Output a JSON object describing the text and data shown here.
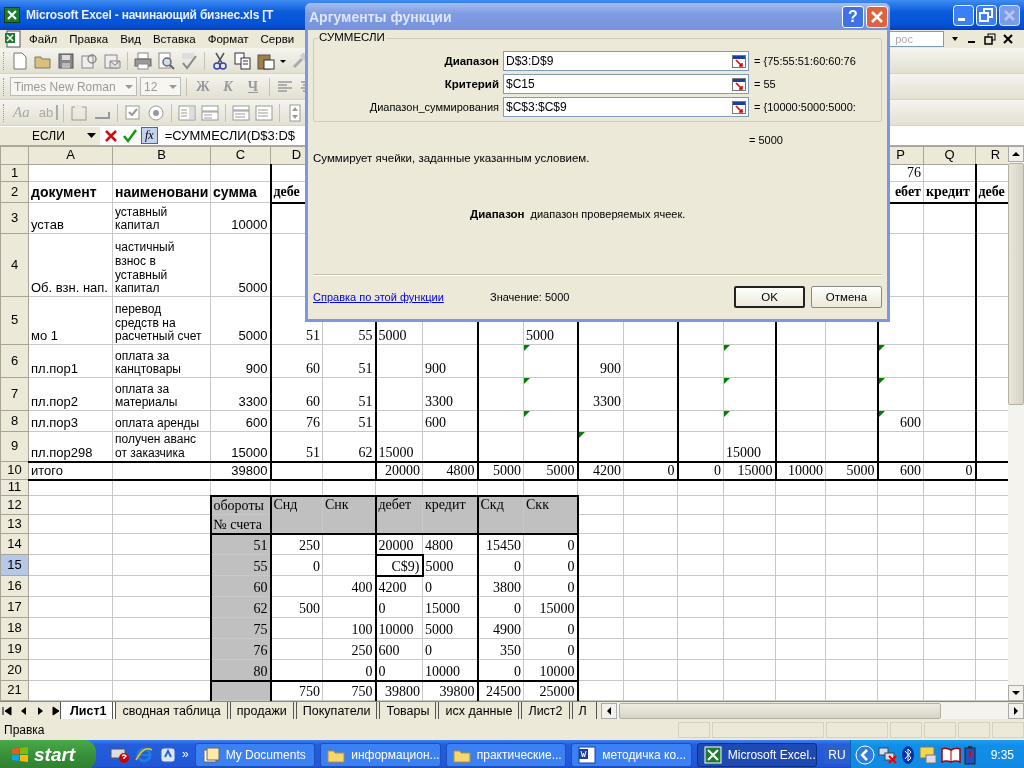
{
  "window": {
    "title": "Microsoft Excel - начинающий бизнес.xls  [T"
  },
  "menu": {
    "items": [
      "Файл",
      "Правка",
      "Вид",
      "Вставка",
      "Формат",
      "Серви"
    ],
    "help_box": {
      "placeholder": "рос"
    }
  },
  "formatting_toolbar": {
    "font": "Times New Roman",
    "size": "12",
    "styles": [
      "Ж",
      "К",
      "Ч"
    ]
  },
  "forms_toolbar": {
    "label_tool": "Aa",
    "edit_box_tool": "ab"
  },
  "formula_bar": {
    "name_box": "ЕСЛИ",
    "function_button": "fx",
    "formula": "=СУММЕСЛИ(D$3:D$"
  },
  "sheet": {
    "columns": [
      "A",
      "B",
      "C",
      "D",
      null,
      null,
      null,
      null,
      null,
      null,
      null,
      null,
      null,
      null,
      null,
      "P",
      "Q",
      "R"
    ],
    "rows": [
      {
        "label": "1",
        "selected": false,
        "cells": {
          "P": "76"
        }
      },
      {
        "label": "2",
        "selected": false,
        "cells": {
          "A": {
            "text": "документ",
            "kind": "header"
          },
          "B": {
            "text": "наименовани",
            "kind": "header"
          },
          "C": {
            "text": "сумма",
            "kind": "header"
          },
          "D": {
            "text": "дебе",
            "kind": "header"
          },
          "P": {
            "text": "ебет",
            "kind": "header_right"
          },
          "Q": {
            "text": "кредит",
            "kind": "header"
          },
          "R": {
            "text": "дебе",
            "kind": "header"
          }
        }
      },
      {
        "label": "3",
        "selected": false,
        "cells": {
          "A": {
            "text": "устав",
            "kind": "text"
          },
          "B": {
            "text": "уставный капитал",
            "kind": "text"
          },
          "C": "10000"
        }
      },
      {
        "label": "4",
        "selected": false,
        "cells": {
          "A": {
            "text": "Об. взн. нап.",
            "kind": "text"
          },
          "B": {
            "text": "частичный взнос в уставный капитал",
            "kind": "text"
          },
          "C": "5000"
        }
      },
      {
        "label": "5",
        "selected": false,
        "cells": {
          "A": {
            "text": "мо 1",
            "kind": "text"
          },
          "B": {
            "text": "перевод средств на расчетный счет",
            "kind": "text"
          },
          "C": "5000",
          "D": "51",
          "E": "55",
          "F": {
            "text": "5000",
            "kind": "text"
          },
          "I": {
            "text": "5000",
            "kind": "text"
          }
        }
      },
      {
        "label": "6",
        "selected": false,
        "cells": {
          "A": {
            "text": "пл.пор1",
            "kind": "text"
          },
          "B": {
            "text": "оплата за канцтовары",
            "kind": "text"
          },
          "C": "900",
          "D": "60",
          "E": "51",
          "G": {
            "text": "900",
            "kind": "text"
          },
          "I": {
            "flagged": true
          },
          "J": "900",
          "M": {
            "flagged": true
          },
          "P": {
            "flagged": true
          }
        }
      },
      {
        "label": "7",
        "selected": false,
        "cells": {
          "A": {
            "text": "пл.пор2",
            "kind": "text"
          },
          "B": {
            "text": "оплата за материалы",
            "kind": "text"
          },
          "C": "3300",
          "D": "60",
          "E": "51",
          "G": {
            "text": "3300",
            "kind": "text"
          },
          "I": {
            "flagged": true
          },
          "J": "3300",
          "M": {
            "flagged": true
          },
          "P": {
            "flagged": true
          }
        }
      },
      {
        "label": "8",
        "selected": false,
        "cells": {
          "A": {
            "text": "пл.пор3",
            "kind": "text"
          },
          "B": {
            "text": "оплата аренды",
            "kind": "text"
          },
          "C": "600",
          "D": "76",
          "E": "51",
          "G": {
            "text": "600",
            "kind": "text"
          },
          "I": {
            "flagged": true
          },
          "M": {
            "flagged": true
          },
          "P": {
            "text": "600",
            "flagged": true
          }
        }
      },
      {
        "label": "9",
        "selected": false,
        "cells": {
          "A": {
            "text": "пл.пор298",
            "kind": "text"
          },
          "B": {
            "text": "получен аванс от заказчика",
            "kind": "text"
          },
          "C": "15000",
          "D": "51",
          "E": "62",
          "F": {
            "text": "15000",
            "kind": "text"
          },
          "J": {
            "flagged": true
          },
          "M": {
            "text": "15000",
            "kind": "text"
          }
        }
      },
      {
        "label": "10",
        "selected": false,
        "cells": {
          "A": {
            "text": "итого",
            "kind": "text"
          },
          "C": "39800",
          "F": "20000",
          "G": "4800",
          "H": "5000",
          "I": "5000",
          "J": "4200",
          "K": "0",
          "L": "0",
          "M": "15000",
          "N": "10000",
          "O": "5000",
          "P": "600",
          "Q": "0"
        }
      },
      {
        "label": "11",
        "selected": false,
        "cells": {}
      },
      {
        "label": "12",
        "selected": false,
        "cells": {
          "C": {
            "text": "обороты",
            "kind": "text",
            "shaded": true
          },
          "D": {
            "text": "Снд",
            "kind": "text",
            "shaded": true,
            "merged": true
          },
          "E": {
            "text": "Снк",
            "kind": "text",
            "shaded": true,
            "merged": true
          },
          "F": {
            "text": "дебет",
            "kind": "text",
            "shaded": true,
            "merged": true
          },
          "G": {
            "text": "кредит",
            "kind": "text",
            "shaded": true,
            "merged": true
          },
          "H": {
            "text": "Скд",
            "kind": "text",
            "shaded": true,
            "merged": true
          },
          "I": {
            "text": "Скк",
            "kind": "text",
            "shaded": true,
            "merged": true
          }
        }
      },
      {
        "label": "13",
        "selected": false,
        "cells": {
          "C": {
            "text": "№ счета",
            "kind": "text",
            "shaded": true
          }
        }
      },
      {
        "label": "14",
        "selected": false,
        "cells": {
          "C": {
            "text": "51",
            "shaded": true
          },
          "D": "250",
          "F": {
            "text": "20000",
            "kind": "text"
          },
          "G": {
            "text": "4800",
            "kind": "text"
          },
          "H": "15450",
          "I": "0"
        }
      },
      {
        "label": "15",
        "selected": true,
        "cells": {
          "C": {
            "text": "55",
            "shaded": true
          },
          "D": "0",
          "F": {
            "text": "C$9)",
            "active": true
          },
          "G": {
            "text": "5000",
            "kind": "text"
          },
          "H": "0",
          "I": "0"
        }
      },
      {
        "label": "16",
        "selected": false,
        "cells": {
          "C": {
            "text": "60",
            "shaded": true
          },
          "E": "400",
          "F": {
            "text": "4200",
            "kind": "text"
          },
          "G": {
            "text": "0",
            "kind": "text"
          },
          "H": "3800",
          "I": "0"
        }
      },
      {
        "label": "17",
        "selected": false,
        "cells": {
          "C": {
            "text": "62",
            "shaded": true
          },
          "D": "500",
          "F": {
            "text": "0",
            "kind": "text"
          },
          "G": {
            "text": "15000",
            "kind": "text"
          },
          "H": "0",
          "I": "15000"
        }
      },
      {
        "label": "18",
        "selected": false,
        "cells": {
          "C": {
            "text": "75",
            "shaded": true
          },
          "E": "100",
          "F": {
            "text": "10000",
            "kind": "text"
          },
          "G": {
            "text": "5000",
            "kind": "text"
          },
          "H": "4900",
          "I": "0"
        }
      },
      {
        "label": "19",
        "selected": false,
        "cells": {
          "C": {
            "text": "76",
            "shaded": true
          },
          "E": "250",
          "F": {
            "text": "600",
            "kind": "text"
          },
          "G": {
            "text": "0",
            "kind": "text"
          },
          "H": "350",
          "I": "0"
        }
      },
      {
        "label": "20",
        "selected": false,
        "cells": {
          "C": {
            "text": "80",
            "shaded": true
          },
          "E": "0",
          "F": {
            "text": "0",
            "kind": "text"
          },
          "G": {
            "text": "10000",
            "kind": "text"
          },
          "H": "0",
          "I": "10000"
        }
      },
      {
        "label": "21",
        "selected": false,
        "cells": {
          "C": {
            "shaded": true
          },
          "D": "750",
          "E": "750",
          "F": "39800",
          "G": "39800",
          "H": "24500",
          "I": "25000"
        }
      }
    ]
  },
  "sheet_tabs": [
    {
      "label": "Лист1",
      "selected": true
    },
    {
      "label": "сводная таблица",
      "selected": false
    },
    {
      "label": "продажи",
      "selected": false
    },
    {
      "label": "Покупатели",
      "selected": false
    },
    {
      "label": "Товары",
      "selected": false
    },
    {
      "label": "исх данные",
      "selected": false
    },
    {
      "label": "Лист2",
      "selected": false
    },
    {
      "label": "Л",
      "selected": false
    }
  ],
  "status_bar": "Правка",
  "taskbar": {
    "start": "start",
    "more": "»",
    "tasks": [
      {
        "label": "My Documents",
        "kind": "docs",
        "selected": false
      },
      {
        "label": "информацион...",
        "kind": "folder",
        "selected": false
      },
      {
        "label": "практические...",
        "kind": "folder",
        "selected": false
      },
      {
        "label": "методичка ко...",
        "kind": "word",
        "selected": false
      },
      {
        "label": "Microsoft Excel...",
        "kind": "excel",
        "selected": true
      }
    ],
    "language": "RU",
    "clock": "9:35"
  },
  "dialog": {
    "title": "Аргументы функции",
    "help_button": "?",
    "function_name": "СУММЕСЛИ",
    "arguments": [
      {
        "label": "Диапазон",
        "required": true,
        "value": "D$3:D$9",
        "result": "= {75:55:51:60:60:76"
      },
      {
        "label": "Критерий",
        "required": true,
        "value": "$C15",
        "result": "= 55"
      },
      {
        "label": "Диапазон_суммирования",
        "required": false,
        "value": "$C$3:$C$9",
        "result": "= {10000:5000:5000:"
      }
    ],
    "formula_result": "= 5000",
    "description": "Суммирует ячейки, заданные указанным условием.",
    "argument_help": {
      "name": "Диапазон",
      "text": "диапазон проверяемых ячеек."
    },
    "help_link": "Справка по этой функции",
    "value_text": "Значение: 5000",
    "buttons": [
      "OK",
      "Отмена"
    ]
  }
}
